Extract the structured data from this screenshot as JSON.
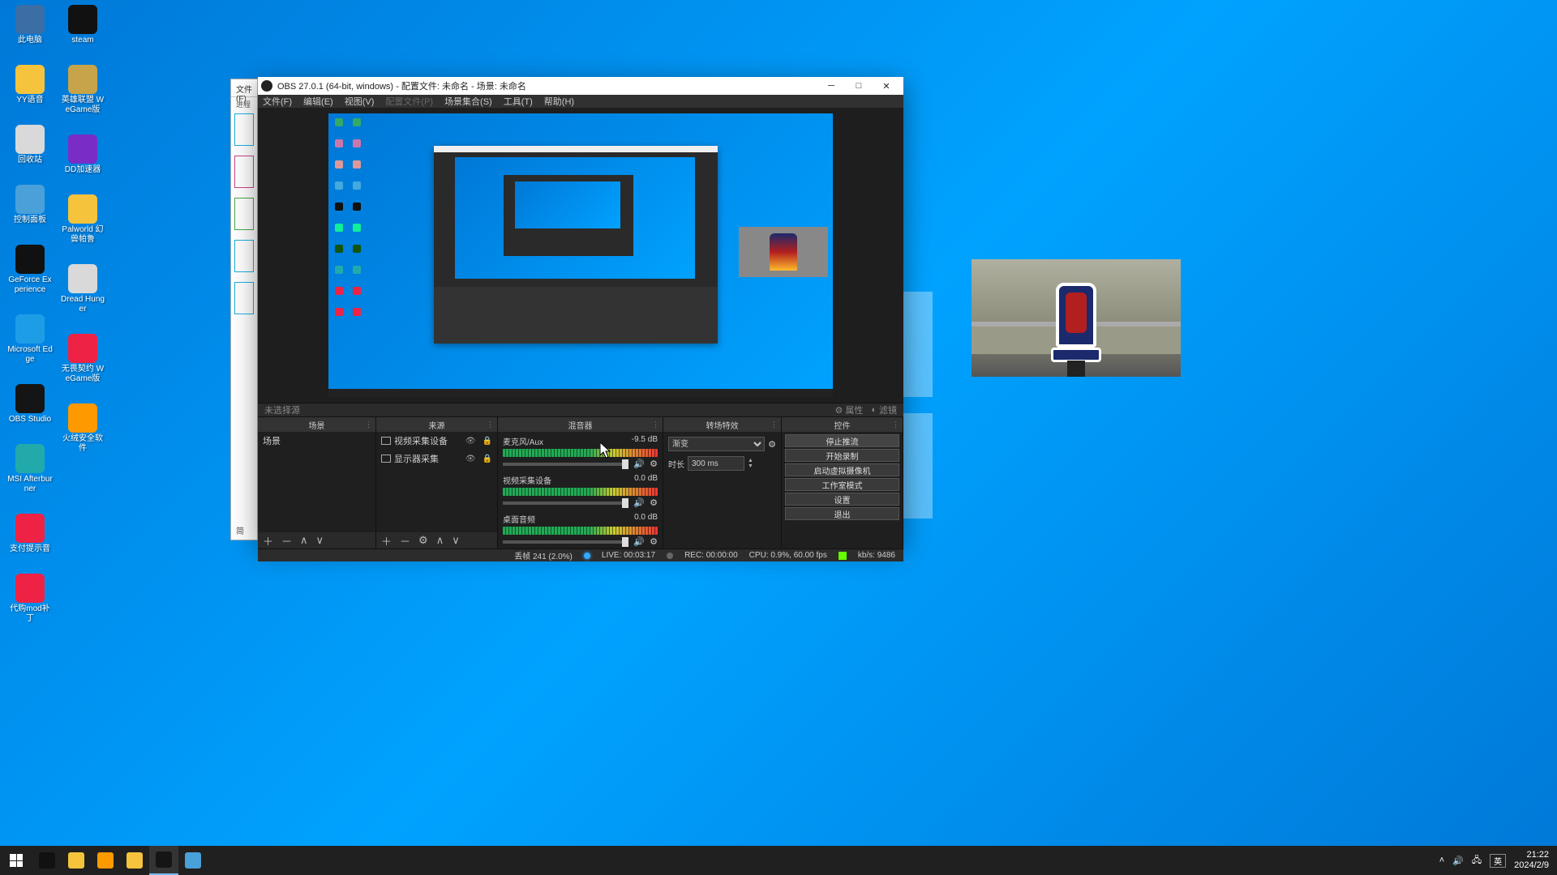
{
  "desktop": {
    "col1": [
      {
        "name": "此电脑",
        "color": "#3a6ea5"
      },
      {
        "name": "YY语音",
        "color": "#f6c33c"
      },
      {
        "name": "回收站",
        "color": "#d9d9d9"
      },
      {
        "name": "控制面板",
        "color": "#4aa0d8"
      },
      {
        "name": "GeForce Experience",
        "color": "#111"
      },
      {
        "name": "Microsoft Edge",
        "color": "#1e9de7"
      },
      {
        "name": "OBS Studio",
        "color": "#151515"
      },
      {
        "name": "MSI Afterburner",
        "color": "#2aa"
      },
      {
        "name": "支付提示音",
        "color": "#e24"
      },
      {
        "name": "代购mod补丁",
        "color": "#e24"
      }
    ],
    "col2": [
      {
        "name": "steam",
        "color": "#111"
      },
      {
        "name": "英雄联盟 WeGame版",
        "color": "#c7a44a"
      },
      {
        "name": "DD加速器",
        "color": "#7a2cc7"
      },
      {
        "name": "Palworld 幻兽帕鲁",
        "color": "#f6c33c"
      },
      {
        "name": "Dread Hunger",
        "color": "#d9d9d9"
      },
      {
        "name": "无畏契约 WeGame版",
        "color": "#e24"
      },
      {
        "name": "火绒安全软件",
        "color": "#f90"
      }
    ]
  },
  "tm": {
    "menu": "文件(F)",
    "tab": "进程",
    "sel": "简"
  },
  "obs": {
    "title": "OBS 27.0.1 (64-bit, windows) - 配置文件: 未命名 - 场景: 未命名",
    "menu": [
      "文件(F)",
      "编辑(E)",
      "视图(V)",
      "配置文件(P)",
      "场景集合(S)",
      "工具(T)",
      "帮助(H)"
    ],
    "toolbar": {
      "noSource": "未选择源",
      "props": "属性",
      "filters": "滤镜"
    },
    "docks": {
      "scenes": {
        "title": "场景",
        "items": [
          "场景"
        ]
      },
      "sources": {
        "title": "来源",
        "items": [
          {
            "label": "视频采集设备",
            "icon": "cam"
          },
          {
            "label": "显示器采集",
            "icon": "disp"
          }
        ]
      },
      "mixer": {
        "title": "混音器",
        "channels": [
          {
            "name": "麦克风/Aux",
            "db": "-9.5 dB"
          },
          {
            "name": "视频采集设备",
            "db": "0.0 dB"
          },
          {
            "name": "桌面音频",
            "db": "0.0 dB"
          }
        ]
      },
      "transitions": {
        "title": "转场特效",
        "selected": "渐变",
        "durLabel": "时长",
        "durValue": "300 ms"
      },
      "controls": {
        "title": "控件",
        "buttons": [
          "停止推流",
          "开始录制",
          "启动虚拟摄像机",
          "工作室模式",
          "设置",
          "退出"
        ]
      }
    },
    "status": {
      "drop": "丢帧 241 (2.0%)",
      "live": "LIVE: 00:03:17",
      "rec": "REC: 00:00:00",
      "cpu": "CPU: 0.9%, 60.00 fps",
      "kbps": "kb/s: 9486"
    }
  },
  "taskbar": {
    "apps": [
      "steam",
      "yy",
      "shield",
      "folder",
      "obs",
      "explorer"
    ],
    "tray": {
      "ime": "英",
      "time": "21:22",
      "date": "2024/2/9"
    }
  }
}
